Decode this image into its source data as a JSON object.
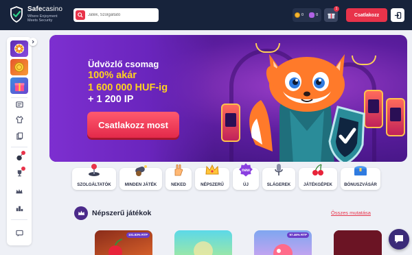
{
  "header": {
    "logo": {
      "name_bold": "Safe",
      "name_light": "casino",
      "tagline_1": "Where Enjoyment",
      "tagline_2": "Meets Security"
    },
    "search": {
      "placeholder": "Játék, Szolgáltató"
    },
    "wallet": {
      "coins": "0",
      "points": "0"
    },
    "gift_badge": "1",
    "login_label": "Csatlakozz"
  },
  "sidebar": {
    "icons": [
      "wheel-icon",
      "coin-icon",
      "gift-box-icon",
      "tournament-icon",
      "shirt-icon",
      "document-icon",
      "bomb-icon",
      "trophy-icon",
      "crown-icon",
      "ranking-icon",
      "chat-icon"
    ]
  },
  "banner": {
    "line1": "Üdvözlő csomag",
    "line2": "100% akár",
    "line3": "1 600 000 HUF-ig",
    "line4": "+ 1 200 IP",
    "cta": "Csatlakozz most",
    "slides": 3,
    "active_slide": 1
  },
  "categories": [
    {
      "label": "SZOLGÁLTATÓK",
      "icon": "joystick-icon"
    },
    {
      "label": "MINDEN JÁTÉK",
      "icon": "cannon-icon"
    },
    {
      "label": "NEKED",
      "icon": "hand-icon"
    },
    {
      "label": "NÉPSZERŰ",
      "icon": "crown-icon"
    },
    {
      "label": "ÚJ",
      "icon": "new-badge-icon",
      "badge": "new"
    },
    {
      "label": "SLÁGEREK",
      "icon": "microphone-icon"
    },
    {
      "label": "JÁTÉKGÉPEK",
      "icon": "cherry-icon"
    },
    {
      "label": "BÓNUSZVÁSÁR",
      "icon": "treasure-chest-icon"
    }
  ],
  "popular": {
    "title": "Népszerű játékok",
    "see_all": "Összes mutatása",
    "games": [
      {
        "rtp": "101.93% RTP"
      },
      {
        "rtp": ""
      },
      {
        "rtp": "97.46% RTP"
      },
      {
        "rtp": ""
      }
    ]
  },
  "colors": {
    "header": "#17233b",
    "accent": "#e8334a",
    "banner_purple": "#6a25bd",
    "highlight": "#ffd21f"
  }
}
